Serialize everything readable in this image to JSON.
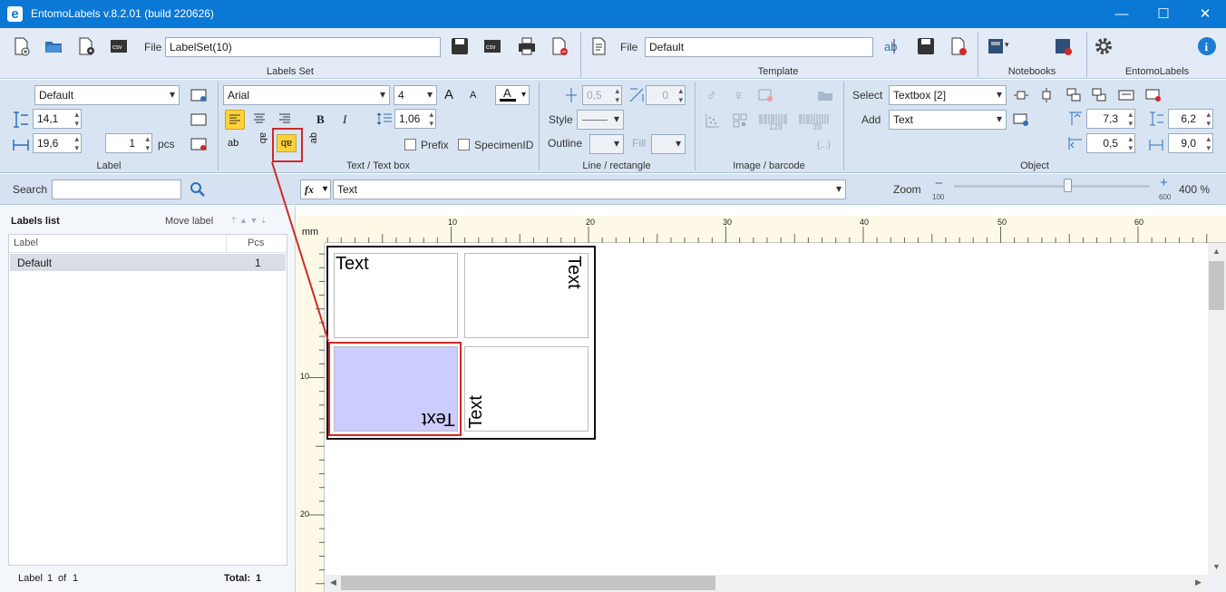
{
  "window": {
    "title": "EntomoLabels v.8.2.01 (build 220626)",
    "logo": "e",
    "min": "—",
    "max": "☐",
    "close": "✕"
  },
  "labels_set": {
    "file_label": "File",
    "file_value": "LabelSet(10)",
    "group": "Labels Set"
  },
  "template": {
    "file_label": "File",
    "file_value": "Default",
    "group": "Template"
  },
  "notebooks": {
    "group": "Notebooks"
  },
  "entomolabels": {
    "group": "EntomoLabels"
  },
  "label_group": {
    "label_select": "Default",
    "height": "14,1",
    "width": "19,6",
    "pcs_value": "1",
    "pcs_label": "pcs",
    "group": "Label"
  },
  "text_group": {
    "font": "Arial",
    "size": "4",
    "grow": "A",
    "shrink": "A",
    "color_letter": "A",
    "line_spacing": "1,06",
    "prefix": "Prefix",
    "specimen_id": "SpecimenID",
    "group": "Text / Text box",
    "bold": "B",
    "italic": "I",
    "align_icons": [
      "ab",
      "ab",
      "ab",
      "ab"
    ]
  },
  "line_group": {
    "width1": "0,5",
    "width2": "0",
    "style_label": "Style",
    "outline_label": "Outline",
    "fill_label": "Fill",
    "group": "Line / rectangle"
  },
  "image_group": {
    "group": "Image / barcode",
    "braces": "{...}",
    "bc1": "128",
    "bc2": "39"
  },
  "object_group": {
    "select_label": "Select",
    "select_value": "Textbox [2]",
    "add_label": "Add",
    "add_value": "Text",
    "top": "7,3",
    "height": "6,2",
    "left": "0,5",
    "width": "9,0",
    "group": "Object"
  },
  "searchbar": {
    "search_label": "Search",
    "search_value": "",
    "fx": "fx",
    "formula": "Text",
    "zoom_label": "Zoom",
    "zoom_min": "100",
    "zoom_max": "600",
    "zoom_value": "400 %",
    "zoom_level": 0.58
  },
  "labels_list": {
    "title": "Labels list",
    "move_label": "Move label",
    "col_label": "Label",
    "col_pcs": "Pcs",
    "rows": [
      {
        "label": "Default",
        "pcs": "1"
      }
    ],
    "footer_label": "Label",
    "footer_page": "1",
    "footer_of": "of",
    "footer_total_pages": "1",
    "footer_total_label": "Total:",
    "footer_total": "1"
  },
  "ruler": {
    "unit": "mm",
    "h_marks": [
      "10",
      "20",
      "30",
      "40",
      "50",
      "60"
    ],
    "v_marks": [
      "10",
      "20"
    ]
  },
  "canvas_cells": [
    {
      "text": "Text",
      "orientation": "normal"
    },
    {
      "text": "Text",
      "orientation": "rotated-90"
    },
    {
      "text": "Text",
      "orientation": "rotated-180",
      "selected": true
    },
    {
      "text": "Text",
      "orientation": "rotated-270"
    }
  ],
  "colors": {
    "titlebar": "#0a78d4",
    "highlight": "#d0282a",
    "selected_fill": "#ccccff",
    "active_button": "#ffd23a"
  }
}
